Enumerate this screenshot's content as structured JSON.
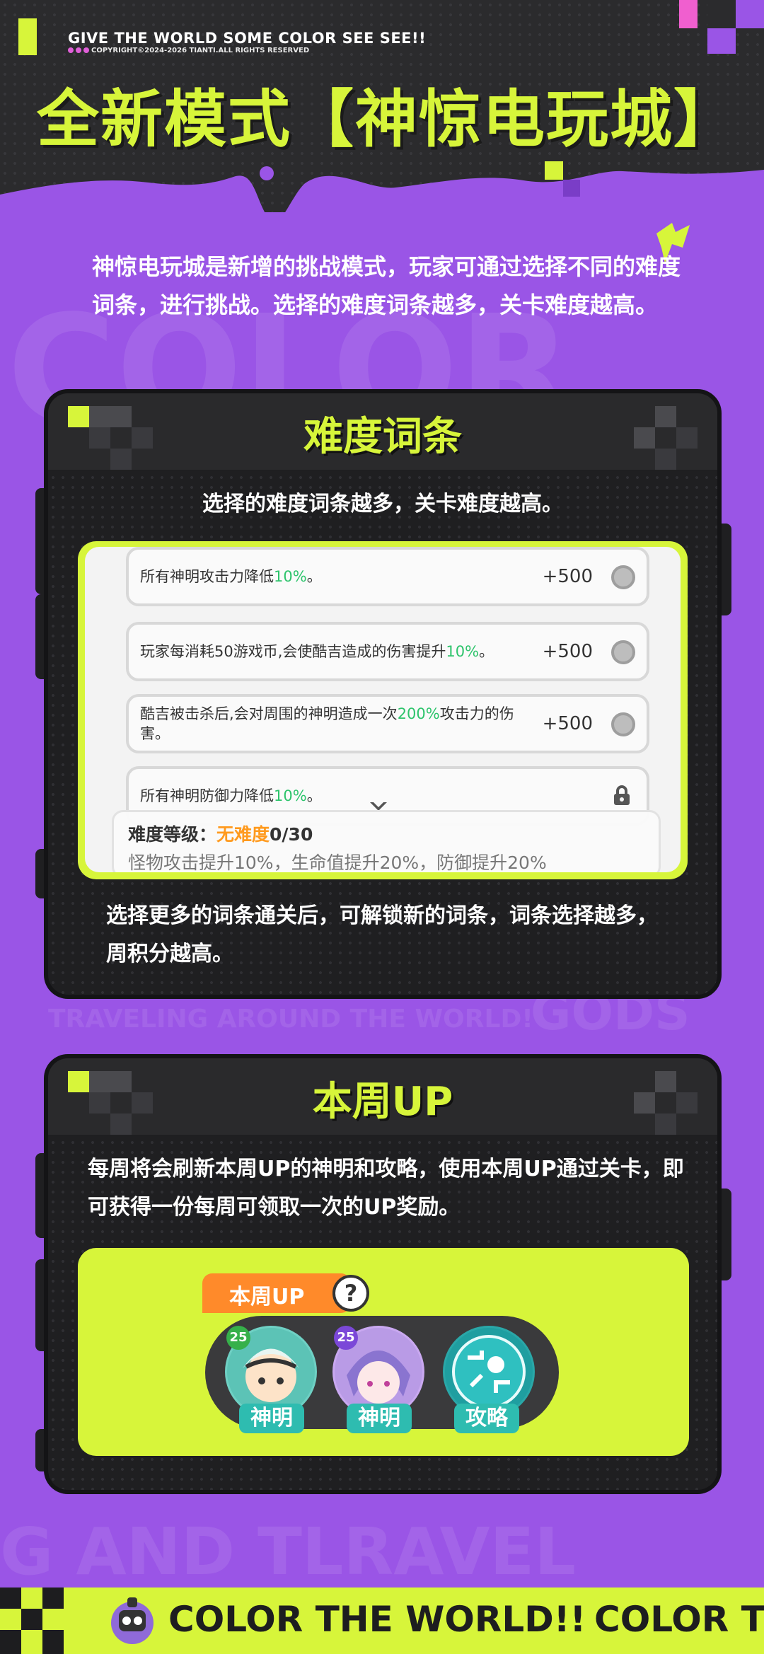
{
  "header": {
    "brand": "GIVE THE WORLD SOME COLOR SEE SEE!!",
    "copyright": "COPYRIGHT©2024-2026 TIANTI.ALL RIGHTS RESERVED",
    "title": "全新模式【神惊电玩城】"
  },
  "intro": "神惊电玩城是新增的挑战模式，玩家可通过选择不同的难度词条，进行挑战。选择的难度词条越多，关卡难度越高。",
  "background_words": [
    "COLOR",
    "TRAVELING AROUND THE WORLD!",
    "GODS",
    "G AND TLRAVEL"
  ],
  "difficulty_panel": {
    "title": "难度词条",
    "subtitle": "选择的难度词条越多，关卡难度越高。",
    "rows": [
      {
        "text": "所有神明攻击力降低",
        "highlight": "10%",
        "suffix": "。",
        "points": "+500"
      },
      {
        "text": "玩家每消耗50游戏币,会使酷吉造成的伤害提升",
        "highlight": "10%",
        "suffix": "。",
        "points": "+500"
      },
      {
        "text": "酷吉被击杀后,会对周围的神明造成一次",
        "highlight": "200%",
        "suffix": "攻击力的伤害。",
        "points": "+500"
      },
      {
        "text": "所有神明防御力降低",
        "highlight": "10%",
        "suffix": "。",
        "points": ""
      }
    ],
    "difficulty_label": "难度等级：",
    "difficulty_value": "无难度",
    "difficulty_count": "0/30",
    "difficulty_effect": "怪物攻击提升10%，生命值提升20%，防御提升20%",
    "footer_text": "选择更多的词条通关后，可解锁新的词条，词条选择越多，周积分越高。"
  },
  "up_panel": {
    "title": "本周UP",
    "description": "每周将会刷新本周UP的神明和攻略，使用本周UP通过关卡，即可获得一份每周可领取一次的UP奖励。",
    "badge": "本周UP",
    "help_icon": "?",
    "cards": [
      {
        "label": "神明",
        "level": "25"
      },
      {
        "label": "神明",
        "level": "25"
      },
      {
        "label": "攻略",
        "level": ""
      }
    ]
  },
  "footer": {
    "marquee": "COLOR THE WORLD!!",
    "marquee_repeat": "COLOR TI"
  },
  "colors": {
    "accent_lime": "#d7f53a",
    "purple": "#9a55e6",
    "dark": "#1f1f21",
    "green_highlight": "#2ec46c",
    "orange": "#ff8a2a"
  }
}
